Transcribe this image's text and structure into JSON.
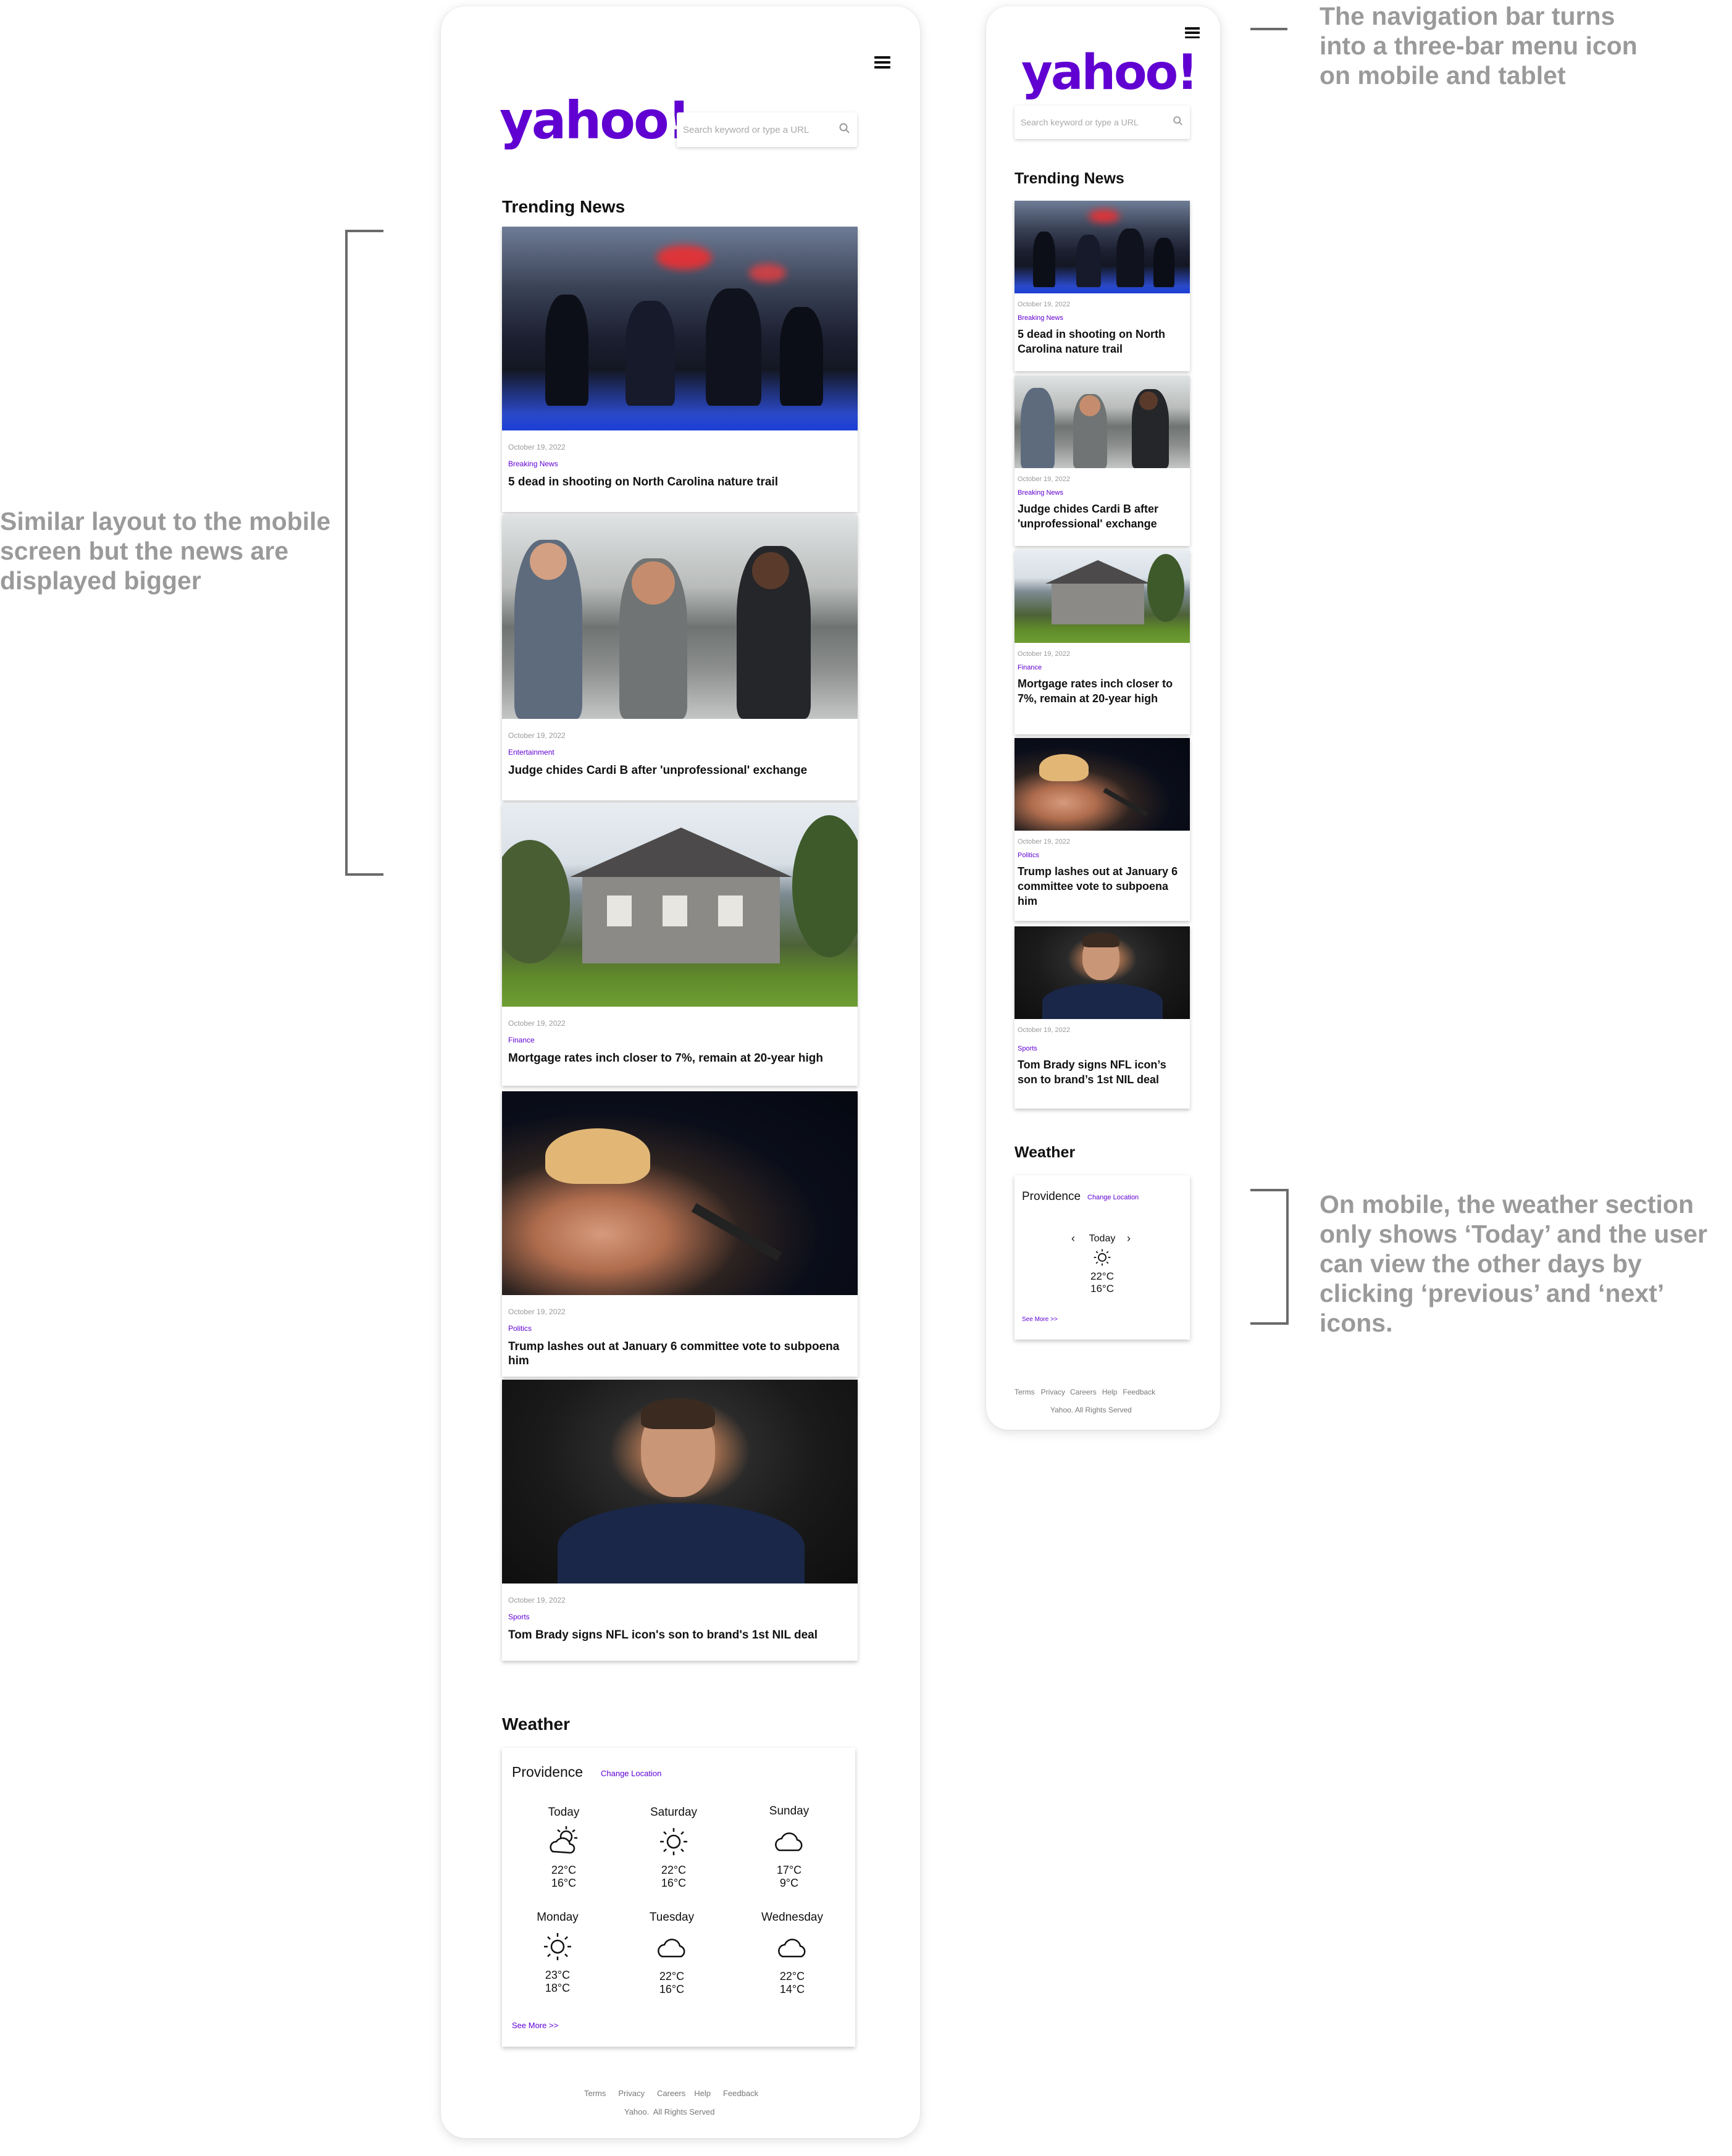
{
  "brand": {
    "logo_text": "yahoo!",
    "accent": "#6001d2"
  },
  "search": {
    "placeholder": "Search keyword or type a URL"
  },
  "trending": {
    "title": "Trending News",
    "articles": [
      {
        "date": "October 19, 2022",
        "category": "Breaking News",
        "headline": "5 dead in shooting on North Carolina nature trail"
      },
      {
        "date": "October 19, 2022",
        "category": "Entertainment",
        "headline": "Judge chides Cardi B after 'unprofessional' exchange"
      },
      {
        "date": "October 19, 2022",
        "category": "Finance",
        "headline": "Mortgage rates inch closer to 7%, remain at 20-year high"
      },
      {
        "date": "October 19, 2022",
        "category": "Politics",
        "headline": "Trump lashes out at January 6 committee vote to subpoena him"
      },
      {
        "date": "October 19, 2022",
        "category": "Sports",
        "headline": "Tom Brady signs NFL icon's son to brand's 1st NIL deal"
      }
    ],
    "mobile_articles": [
      {
        "date": "October 19, 2022",
        "category": "Breaking News",
        "headline": "5 dead in shooting on North Carolina nature trail"
      },
      {
        "date": "October 19, 2022",
        "category": "Breaking News",
        "headline": "Judge chides Cardi B after 'unprofessional' exchange"
      },
      {
        "date": "October 19, 2022",
        "category": "Finance",
        "headline": "Mortgage rates inch closer to 7%, remain at 20-year high"
      },
      {
        "date": "October 19, 2022",
        "category": "Politics",
        "headline": "Trump lashes out at January 6 committee vote to subpoena him"
      },
      {
        "date": "October 19, 2022",
        "category": "Sports",
        "headline": "Tom Brady signs NFL icon’s son to brand’s 1st NIL deal"
      }
    ]
  },
  "weather": {
    "title": "Weather",
    "city": "Providence",
    "change_location": "Change Location",
    "see_more": "See More >>",
    "days": [
      {
        "name": "Today",
        "icon": "partly-sunny-icon",
        "high": "22°C",
        "low": "16°C"
      },
      {
        "name": "Saturday",
        "icon": "sun-icon",
        "high": "22°C",
        "low": "16°C"
      },
      {
        "name": "Sunday",
        "icon": "cloud-icon",
        "high": "17°C",
        "low": "9°C"
      },
      {
        "name": "Monday",
        "icon": "sun-icon",
        "high": "23°C",
        "low": "18°C"
      },
      {
        "name": "Tuesday",
        "icon": "cloud-icon",
        "high": "22°C",
        "low": "16°C"
      },
      {
        "name": "Wednesday",
        "icon": "cloud-icon",
        "high": "22°C",
        "low": "14°C"
      }
    ],
    "mobile_today": {
      "name": "Today",
      "icon": "sun-icon",
      "high": "22°C",
      "low": "16°C"
    }
  },
  "footer": {
    "links": [
      "Terms",
      "Privacy",
      "Careers",
      "Help",
      "Feedback"
    ],
    "copyright_tablet": "Yahoo.  All Rights Served",
    "copyright_mobile": "Yahoo. All Rights Served"
  },
  "annotations": {
    "left_note": "Similar layout to the mobile screen but the news are displayed bigger",
    "nav_note": "The navigation bar turns into a three-bar menu icon on mobile and tablet",
    "weather_note": "On mobile, the weather section only shows ‘Today’ and the user can view the other days by clicking ‘previous’ and ‘next’ icons."
  }
}
